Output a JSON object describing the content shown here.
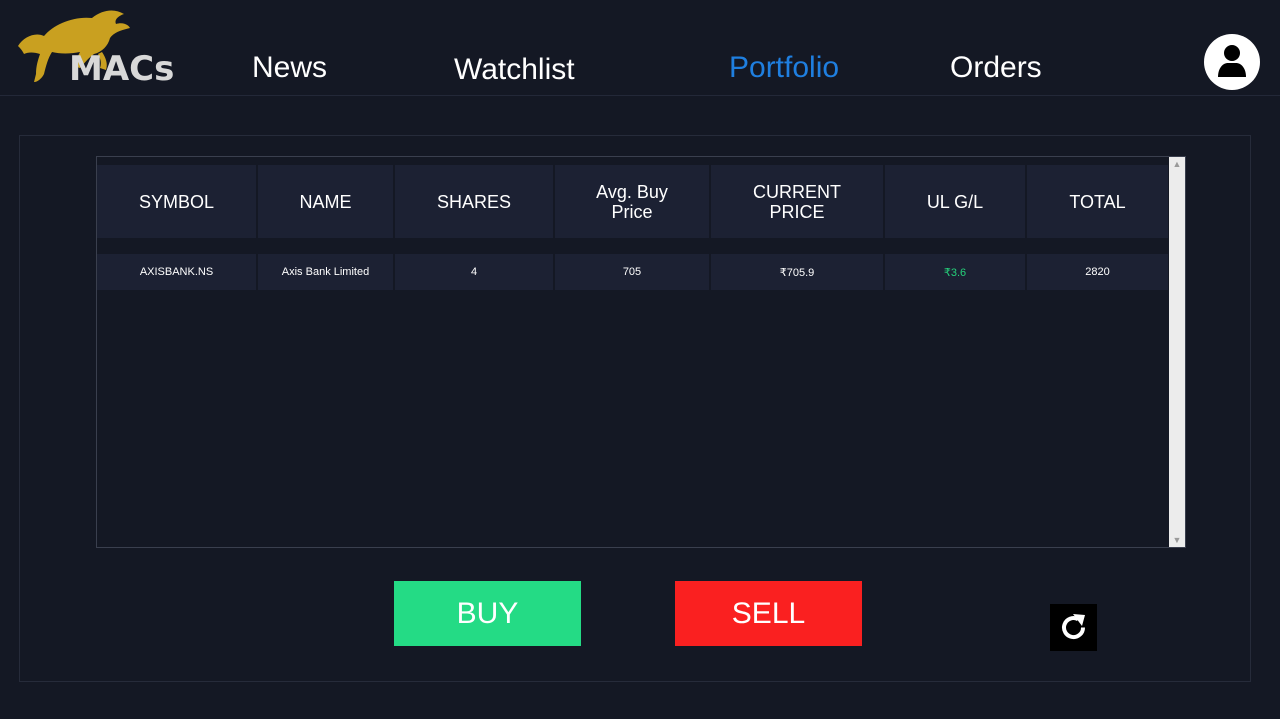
{
  "brand": {
    "name": "MACs",
    "logo_icon": "bull-icon",
    "logo_color": "#c9a020"
  },
  "nav": {
    "items": [
      {
        "label": "News",
        "active": false
      },
      {
        "label": "Watchlist",
        "active": false
      },
      {
        "label": "Portfolio",
        "active": true
      },
      {
        "label": "Orders",
        "active": false
      }
    ],
    "active_color": "#1f7fe0"
  },
  "user": {
    "icon": "user-avatar-icon"
  },
  "portfolio_table": {
    "columns": [
      "SYMBOL",
      "NAME",
      "SHARES",
      "Avg. Buy\nPrice",
      "CURRENT\nPRICE",
      "UL G/L",
      "TOTAL"
    ],
    "rows": [
      {
        "symbol": "AXISBANK.NS",
        "name": "Axis Bank Limited",
        "shares": "4",
        "avg_buy_price": "705",
        "current_price": "₹705.9",
        "ul_gl": "₹3.6",
        "total": "2820"
      }
    ],
    "gain_color": "#25d07a"
  },
  "actions": {
    "buy_label": "BUY",
    "sell_label": "SELL",
    "buy_color": "#24db85",
    "sell_color": "#fa2020",
    "refresh_icon": "refresh-icon"
  }
}
